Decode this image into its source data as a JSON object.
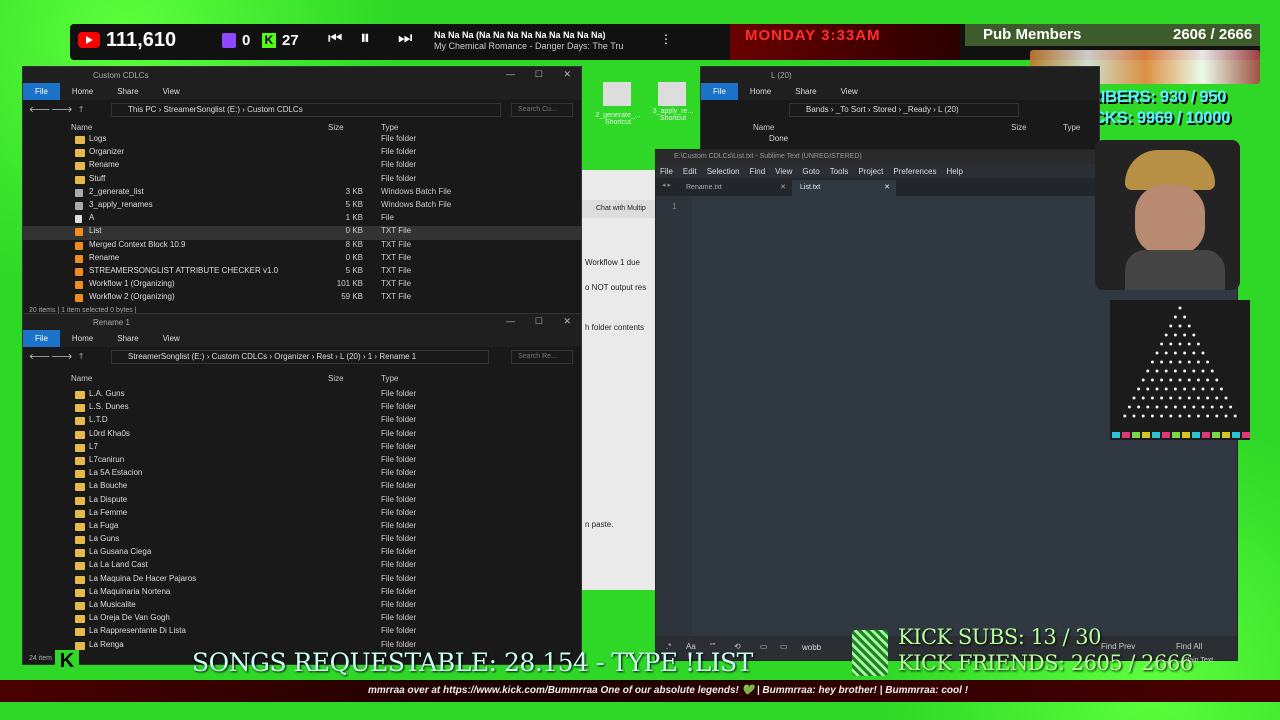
{
  "overlay": {
    "yt_count": "111,610",
    "twitch_count": "0",
    "kick_count": "27",
    "song_title": "Na Na Na (Na Na Na Na Na Na Na Na Na)",
    "song_artist": "My Chemical Romance - Danger Days: The Tru",
    "day_time": "MONDAY 3:33AM",
    "pub_members_label": "Pub Members",
    "pub_members_count": "2606 / 2666",
    "subscribers": "SUBSCRIBERS: 930 / 950",
    "kicks": "KICKS: 9969 / 10000",
    "songs_requestable": "SONGS REQUESTABLE: 28.154 - TYPE !LIST",
    "kick_subs": "KICK SUBS: 13 / 30",
    "kick_friends": "KICK FRIENDS: 2605 / 2666",
    "ticker": "mmrraa over at https://www.kick.com/Bummrraa One of our absolute legends! 💚 | Bummrraa: hey brother! | Bummrraa: cool !"
  },
  "desktop": {
    "icon1": "2_generate_... Shortcut",
    "icon2": "3_apply_re... Shortcut"
  },
  "ribbon": {
    "file": "File",
    "home": "Home",
    "share": "Share",
    "view": "View"
  },
  "win1": {
    "title": "Custom CDLCs",
    "path": "This PC  ›  StreamerSonglist (E:)  ›  Custom CDLCs",
    "search": "Search Cu...",
    "col_name": "Name",
    "col_size": "Size",
    "col_type": "Type",
    "rows": [
      {
        "name": "Logs",
        "size": "",
        "type": "File folder",
        "icon": "folder"
      },
      {
        "name": "Organizer",
        "size": "",
        "type": "File folder",
        "icon": "folder"
      },
      {
        "name": "Rename",
        "size": "",
        "type": "File folder",
        "icon": "folder"
      },
      {
        "name": "Stuff",
        "size": "",
        "type": "File folder",
        "icon": "folder"
      },
      {
        "name": "2_generate_list",
        "size": "3 KB",
        "type": "Windows Batch File",
        "icon": "bat"
      },
      {
        "name": "3_apply_renames",
        "size": "5 KB",
        "type": "Windows Batch File",
        "icon": "bat"
      },
      {
        "name": "A",
        "size": "1 KB",
        "type": "File",
        "icon": "blank"
      },
      {
        "name": "List",
        "size": "0 KB",
        "type": "TXT File",
        "icon": "txt"
      },
      {
        "name": "Merged Context Block 10.9",
        "size": "8 KB",
        "type": "TXT File",
        "icon": "txt"
      },
      {
        "name": "Rename",
        "size": "0 KB",
        "type": "TXT File",
        "icon": "txt"
      },
      {
        "name": "STREAMERSONGLIST ATTRIBUTE CHECKER v1.0",
        "size": "5 KB",
        "type": "TXT File",
        "icon": "txt"
      },
      {
        "name": "Workflow 1 (Organizing)",
        "size": "101 KB",
        "type": "TXT File",
        "icon": "txt"
      },
      {
        "name": "Workflow 2 (Organizing)",
        "size": "59 KB",
        "type": "TXT File",
        "icon": "txt"
      }
    ],
    "status": "20 items   |   1 item selected  0 bytes   |"
  },
  "win2": {
    "title": "Rename 1",
    "path": "StreamerSonglist (E:)  ›  Custom CDLCs  ›  Organizer  ›  Rest  ›  L (20)  ›  1  ›  Rename 1",
    "search": "Search Re...",
    "col_name": "Name",
    "col_size": "Size",
    "col_type": "Type",
    "rows": [
      {
        "name": "L.A. Guns",
        "type": "File folder"
      },
      {
        "name": "L.S. Dunes",
        "type": "File folder"
      },
      {
        "name": "L.T.D",
        "type": "File folder"
      },
      {
        "name": "L0rd Kha0s",
        "type": "File folder"
      },
      {
        "name": "L7",
        "type": "File folder"
      },
      {
        "name": "L7canirun",
        "type": "File folder"
      },
      {
        "name": "La 5A Estacion",
        "type": "File folder"
      },
      {
        "name": "La Bouche",
        "type": "File folder"
      },
      {
        "name": "La Dispute",
        "type": "File folder"
      },
      {
        "name": "La Femme",
        "type": "File folder"
      },
      {
        "name": "La Fuga",
        "type": "File folder"
      },
      {
        "name": "La Guns",
        "type": "File folder"
      },
      {
        "name": "La Gusana Ciega",
        "type": "File folder"
      },
      {
        "name": "La La Land Cast",
        "type": "File folder"
      },
      {
        "name": "La Maquina De Hacer Pajaros",
        "type": "File folder"
      },
      {
        "name": "La Maquinaria Nortena",
        "type": "File folder"
      },
      {
        "name": "La Musicalite",
        "type": "File folder"
      },
      {
        "name": "La Oreja De Van Gogh",
        "type": "File folder"
      },
      {
        "name": "La Rappresentante Di Lista",
        "type": "File folder"
      },
      {
        "name": "La Renga",
        "type": "File folder"
      }
    ],
    "status": "24 item"
  },
  "win3": {
    "title": "L (20)",
    "path": "Bands  ›  _To Sort  ›  Stored  ›  _Ready  ›  L (20)",
    "col_name": "Name",
    "col_size": "Size",
    "col_type": "Type",
    "row": "Done"
  },
  "chat_behind": {
    "tab": "Chat with Multip",
    "l1": "Workflow 1 due",
    "l2": "o NOT output res",
    "l3": "h folder contents",
    "l4": "n paste."
  },
  "sublime": {
    "title": "E:\\Custom CDLCs\\List.txt - Sublime Text (UNREGISTERED)",
    "menu": [
      "File",
      "Edit",
      "Selection",
      "Find",
      "View",
      "Goto",
      "Tools",
      "Project",
      "Preferences",
      "Help"
    ],
    "tab1": "Rename.txt",
    "tab2": "List.txt",
    "line_no": "1",
    "find_value": "wobb",
    "find_prev": "Find Prev",
    "find_all": "Find All",
    "syntax": "Plain Text"
  }
}
